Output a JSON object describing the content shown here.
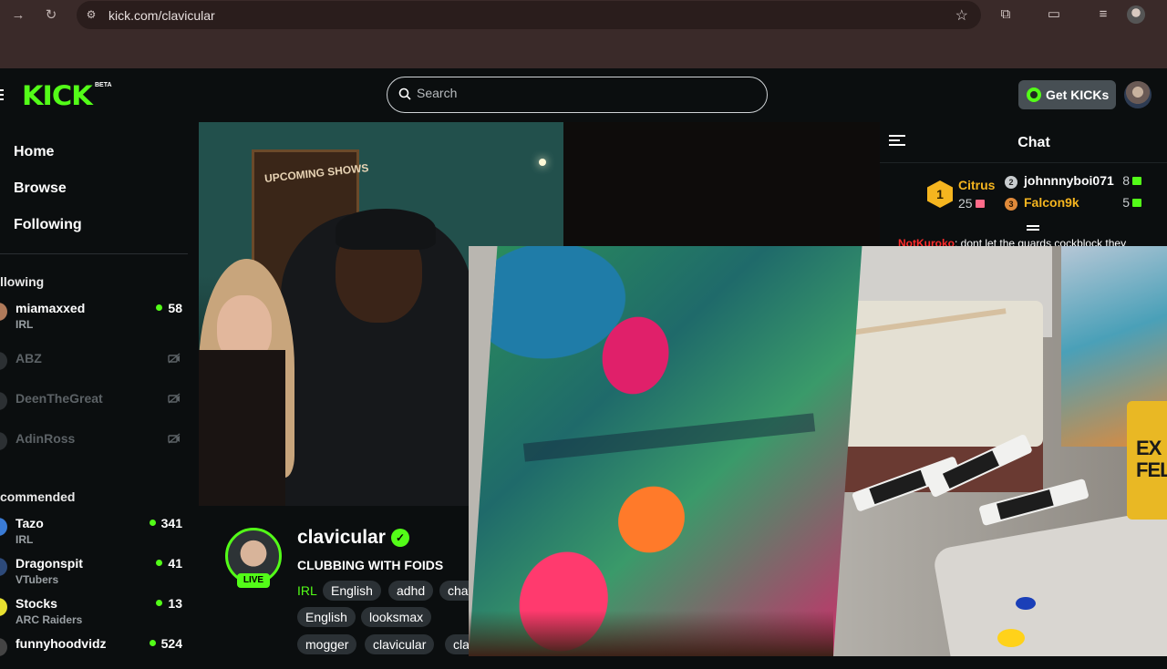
{
  "browser": {
    "url": "kick.com/clavicular",
    "icons": [
      "forward-icon",
      "reload-icon",
      "site-settings-icon",
      "bookmark-star-icon",
      "extensions-icon",
      "cast-icon",
      "media-controls-icon",
      "profile-icon"
    ]
  },
  "topbar": {
    "logo": "KICK",
    "beta": "BETA",
    "search_placeholder": "Search",
    "get_kicks": "Get KICKs"
  },
  "sidebar": {
    "nav": [
      "Home",
      "Browse",
      "Following"
    ],
    "following_title": "llowing",
    "following": [
      {
        "name": "miamaxxed",
        "category": "IRL",
        "viewers": "58",
        "live": true,
        "avatar_color": "#b07a5a"
      },
      {
        "name": "ABZ",
        "live": false
      },
      {
        "name": "DeenTheGreat",
        "live": false
      },
      {
        "name": "AdinRoss",
        "live": false
      }
    ],
    "recommended_title": "commended",
    "recommended": [
      {
        "name": "Tazo",
        "category": "IRL",
        "viewers": "341",
        "avatar_color": "#3a7bd5"
      },
      {
        "name": "Dragonspit",
        "category": "VTubers",
        "viewers": "41",
        "avatar_color": "#2d4a7a"
      },
      {
        "name": "Stocks",
        "category": "ARC Raiders",
        "viewers": "13",
        "avatar_color": "#e8e030"
      },
      {
        "name": "funnyhoodvidz",
        "category": "",
        "viewers": "524",
        "avatar_color": "#444"
      }
    ]
  },
  "video": {
    "board_text": "UPCOMING SHOWS"
  },
  "overlay": {
    "can_text": "EX\nFELC"
  },
  "chat": {
    "title": "Chat",
    "leaderboard": {
      "first": {
        "rank": "1",
        "name": "Citrus",
        "count": "25"
      },
      "others": [
        {
          "rank": "2",
          "name": "johnnnyboi071",
          "count": "8",
          "color": "#ffffff",
          "badge_color": "#c9cdcf"
        },
        {
          "rank": "3",
          "name": "Falcon9k",
          "count": "5",
          "color": "#f5b51f",
          "badge_color": "#e08a3a"
        }
      ]
    },
    "message": {
      "user": "NotKuroko",
      "text": ": dont let the guards cockblock they"
    }
  },
  "stream": {
    "streamer": "clavicular",
    "live_label": "LIVE",
    "title": "CLUBBING WITH FOIDS",
    "category": "IRL",
    "tags_row1": [
      "English",
      "adhd",
      "chat"
    ],
    "tags_row2": [
      "English",
      "looksmax"
    ],
    "tags_row3": [
      "mogger",
      "clavicular",
      "cla"
    ]
  },
  "colors": {
    "accent": "#53fc18",
    "background": "#0b0e0f",
    "browser_chrome": "#3a2a29",
    "gold": "#f5b51f"
  }
}
